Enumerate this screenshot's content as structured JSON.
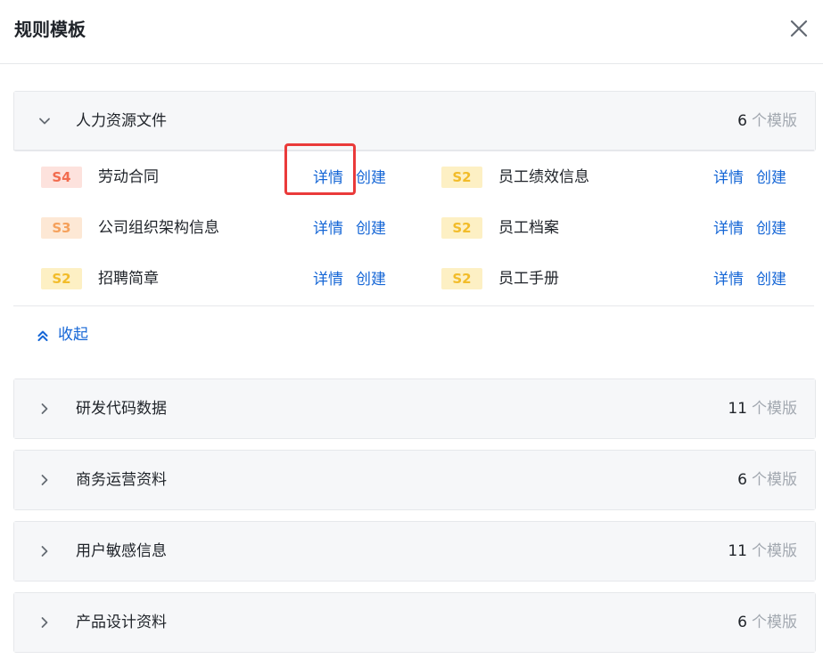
{
  "dialog": {
    "title": "规则模板",
    "close_icon": "close-icon"
  },
  "unit_label": "个模版",
  "actions": {
    "detail": "详情",
    "create": "创建"
  },
  "expanded_group": {
    "name": "人力资源文件",
    "count": "6",
    "expanded": true,
    "items": [
      {
        "level": "S4",
        "name": "劳动合同"
      },
      {
        "level": "S2",
        "name": "员工绩效信息"
      },
      {
        "level": "S3",
        "name": "公司组织架构信息"
      },
      {
        "level": "S2",
        "name": "员工档案"
      },
      {
        "level": "S2",
        "name": "招聘简章"
      },
      {
        "level": "S2",
        "name": "员工手册"
      }
    ],
    "collapse_label": "收起"
  },
  "collapsed_groups": [
    {
      "name": "研发代码数据",
      "count": "11"
    },
    {
      "name": "商务运营资料",
      "count": "6"
    },
    {
      "name": "用户敏感信息",
      "count": "11"
    },
    {
      "name": "产品设计资料",
      "count": "6"
    }
  ],
  "colors": {
    "accent_link": "#1566d6",
    "s4_bg": "#fde2dd",
    "s4_fg": "#f26c4f",
    "s3_bg": "#fde8d5",
    "s3_fg": "#f5a15c",
    "s2_bg": "#fdf0c4",
    "s2_fg": "#f2bc2a",
    "highlight_box": "#ea3a3a"
  }
}
